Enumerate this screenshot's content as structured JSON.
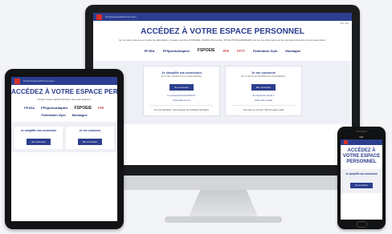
{
  "desktop": {
    "topbar_text": "Portail EspaceMonFormateur",
    "heading": "ACCÉDEZ À VOTRE ESPACE PERSONNEL",
    "subtitle": "En un point unique pour toutes les fédérations, l'espace membre (FSPOEIE, CNOSF, Préventica, TOTAL/TOTALENERGIES) de voir les informations et les données d'activité et leurs paramètres",
    "lang": [
      "FR",
      "EN"
    ],
    "logos": [
      "FFJDA",
      "FFSportsAdaptés",
      "FSPOEIE",
      "FFE",
      "FFTT",
      "Fédération Gym",
      "Montagne"
    ],
    "card_left": {
      "title": "Je simplifie ma connexion",
      "text": "En un clic, accédez à vos comptes fédéraux",
      "button": "Se connecter",
      "link1": "Un compte personnel fédéral ?",
      "link2": "Connectez-vous ici"
    },
    "card_right": {
      "title": "Je me connecte",
      "text": "En un clic sur les identifiants de votre fédération",
      "button": "Me connecter",
      "link1": "Je n'ai pas de compte ?",
      "link2": "Créer votre compte"
    },
    "login_left": "En vous identifiant, vous acceptez les conditions générales",
    "login_right": "Vous avez un compte ? Mot de passe oublié"
  },
  "tablet": {
    "heading": "ACCÉDEZ À VOTRE ESPACE PERSONNEL",
    "subtitle": "Portail unique d'authentification des sites fédéraux",
    "card_left_title": "Je simplifie ma connexion",
    "card_right_title": "Je me connecte",
    "button_left": "Se connecter",
    "button_right": "Me connecter"
  },
  "phone": {
    "status": "9:41",
    "heading": "ACCÉDEZ À VOTRE ESPACE PERSONNEL",
    "card_title": "Je simplifie ma connexion",
    "button": "Se connecter"
  },
  "colors": {
    "brand": "#2c3e8f",
    "accent": "#d6322b",
    "background": "#f3f4f6"
  }
}
